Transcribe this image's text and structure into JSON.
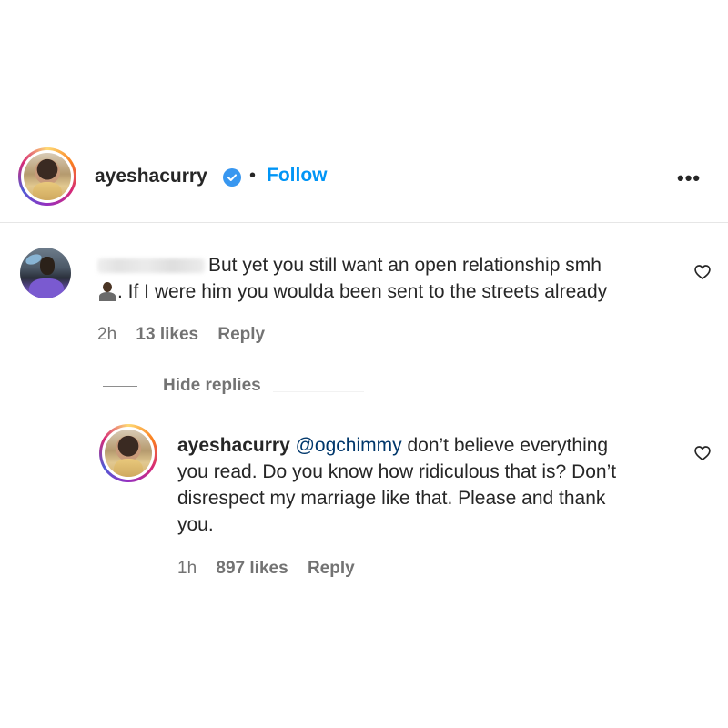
{
  "post_header": {
    "username": "ayeshacurry",
    "separator": "•",
    "follow_label": "Follow",
    "more_label": "•••",
    "verified_icon": "verified-badge-icon",
    "accent_color": "#0095f6"
  },
  "comment1": {
    "text_line1": "But yet you still want an open relationship smh",
    "text_line2": ". If I were him you woulda been sent to the streets already",
    "time": "2h",
    "likes": "13 likes",
    "reply_label": "Reply",
    "like_icon": "heart-outline-icon"
  },
  "replies_toggle": {
    "label": "Hide replies"
  },
  "reply1": {
    "username": "ayeshacurry",
    "mention": "@ogchimmy",
    "text_line1": " don’t believe everything",
    "text_line2": "you read. Do you know how ridiculous that is? Don’t",
    "text_line3": "disrespect my marriage like that. Please and thank",
    "text_line4": "you.",
    "time": "1h",
    "likes": "897 likes",
    "reply_label": "Reply",
    "mention_color": "#00376b",
    "like_icon": "heart-outline-icon"
  }
}
